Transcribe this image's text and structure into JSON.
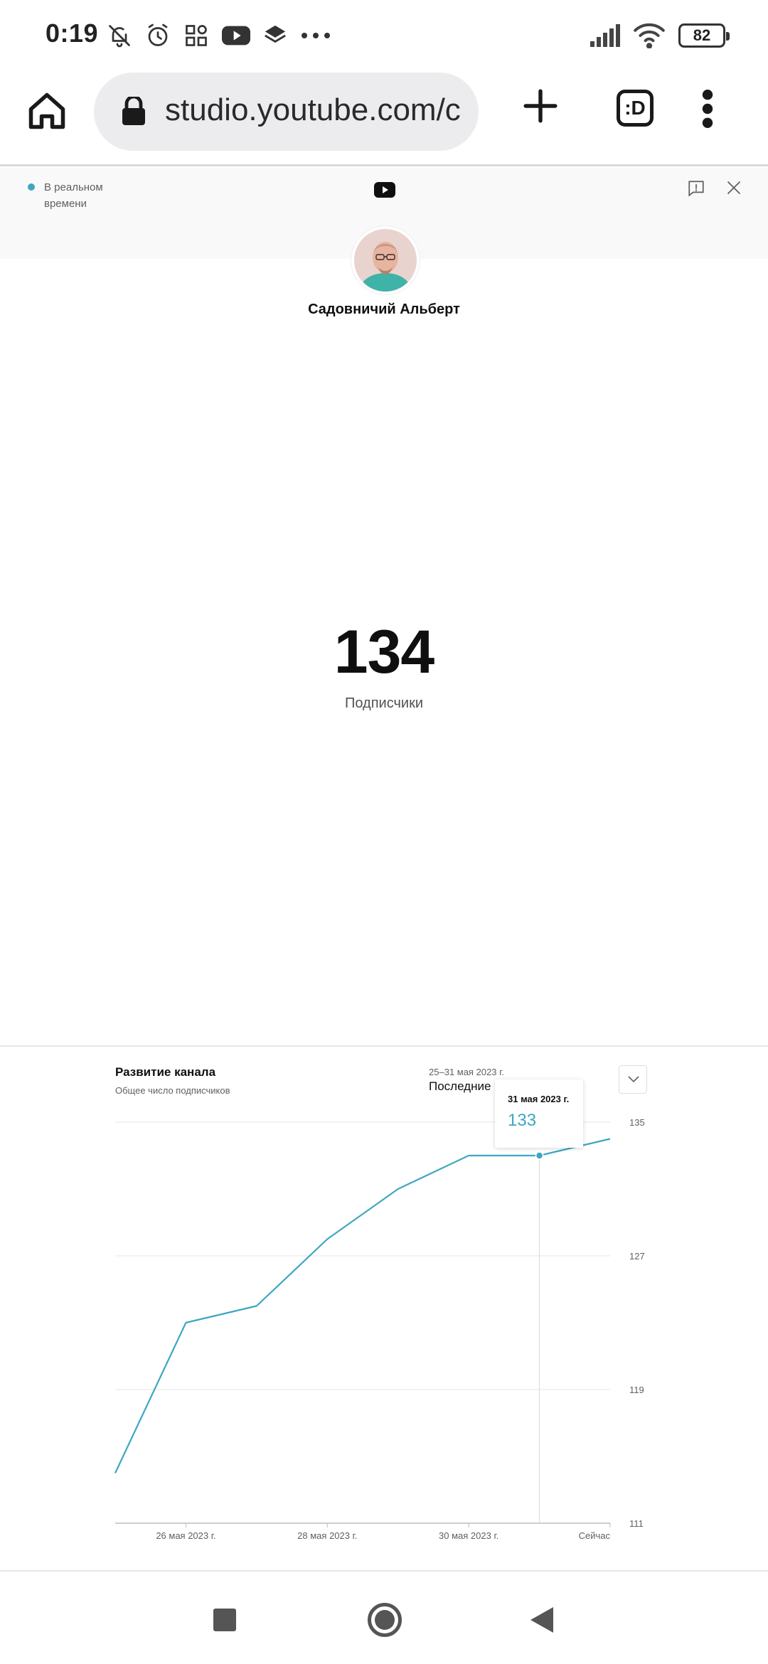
{
  "status_bar": {
    "time": "0:19",
    "battery": "82",
    "left_icons": [
      "bell-off-icon",
      "alarm-icon",
      "grid-icon",
      "youtube-icon",
      "layers-icon",
      "more-dots-icon"
    ],
    "right_icons": [
      "signal-icon",
      "wifi-icon",
      "battery-icon"
    ]
  },
  "browser": {
    "url": "studio.youtube.com/c",
    "tabs_label": ":D"
  },
  "live": {
    "label": "В реальном времени",
    "dot_color": "#3ea6c2"
  },
  "channel": {
    "name": "Садовничий Альберт"
  },
  "counter": {
    "value": "134",
    "label": "Подписчики"
  },
  "chart_section": {
    "title": "Развитие канала",
    "subtitle": "Общее число подписчиков",
    "range_dates": "25–31 мая 2023 г.",
    "range_select": "Последние 7"
  },
  "tooltip": {
    "date": "31 мая 2023 г.",
    "value": "133"
  },
  "chart_data": {
    "type": "line",
    "title": "Развитие канала",
    "subtitle": "Общее число подписчиков",
    "x": [
      "25 мая",
      "26 мая 2023 г.",
      "27 мая",
      "28 мая 2023 г.",
      "29 мая",
      "30 мая 2023 г.",
      "31 мая 2023 г.",
      "Сейчас"
    ],
    "x_tick_labels": [
      "26 мая 2023 г.",
      "28 мая 2023 г.",
      "30 мая 2023 г.",
      "Сейчас"
    ],
    "series": [
      {
        "values": [
          114,
          123,
          124,
          128,
          131,
          133,
          133,
          134
        ],
        "color": "#3ea6c2"
      }
    ],
    "y_ticks": [
      111,
      119,
      127,
      135
    ],
    "ylim": [
      111,
      135
    ],
    "grid": true,
    "y_axis_side": "right",
    "highlight": {
      "x": "31 мая 2023 г.",
      "y": 133
    }
  }
}
